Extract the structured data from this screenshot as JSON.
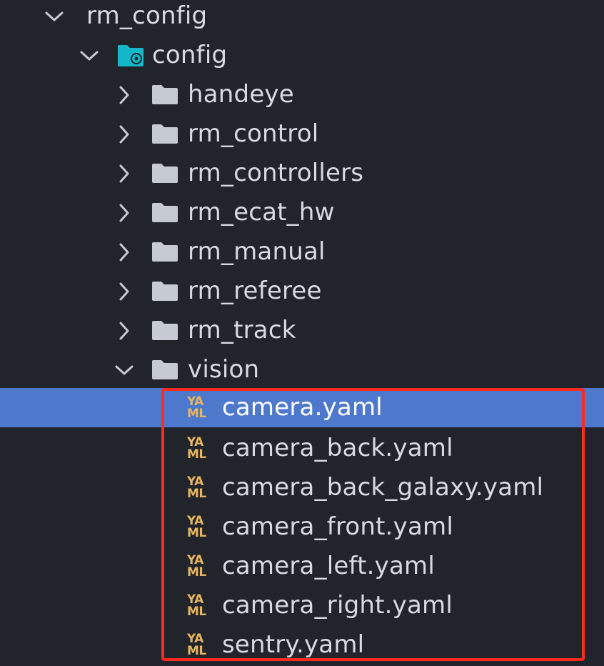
{
  "tree": {
    "root": {
      "label": "rm_config",
      "expanded": true
    },
    "config": {
      "label": "config",
      "expanded": true
    },
    "folders": [
      {
        "label": "handeye",
        "expanded": false
      },
      {
        "label": "rm_control",
        "expanded": false
      },
      {
        "label": "rm_controllers",
        "expanded": false
      },
      {
        "label": "rm_ecat_hw",
        "expanded": false
      },
      {
        "label": "rm_manual",
        "expanded": false
      },
      {
        "label": "rm_referee",
        "expanded": false
      },
      {
        "label": "rm_track",
        "expanded": false
      },
      {
        "label": "vision",
        "expanded": true
      }
    ],
    "files": [
      {
        "label": "camera.yaml",
        "selected": true
      },
      {
        "label": "camera_back.yaml",
        "selected": false
      },
      {
        "label": "camera_back_galaxy.yaml",
        "selected": false
      },
      {
        "label": "camera_front.yaml",
        "selected": false
      },
      {
        "label": "camera_left.yaml",
        "selected": false
      },
      {
        "label": "camera_right.yaml",
        "selected": false
      },
      {
        "label": "sentry.yaml",
        "selected": false
      }
    ],
    "yaml_icon": {
      "top": "YA",
      "bottom": "ML"
    }
  },
  "colors": {
    "background": "#21252b",
    "text": "#d7dae0",
    "selection": "#4d78cc",
    "folder": "#c5cad3",
    "config_folder": "#13b7c9",
    "yaml_icon": "#e5b562",
    "highlight_border": "#ff2b1f"
  },
  "icons": {
    "chevron_expanded": "chevron-down-icon",
    "chevron_collapsed": "chevron-right-icon",
    "folder": "folder-icon",
    "config_folder": "folder-settings-icon",
    "yaml": "yaml-file-icon"
  }
}
